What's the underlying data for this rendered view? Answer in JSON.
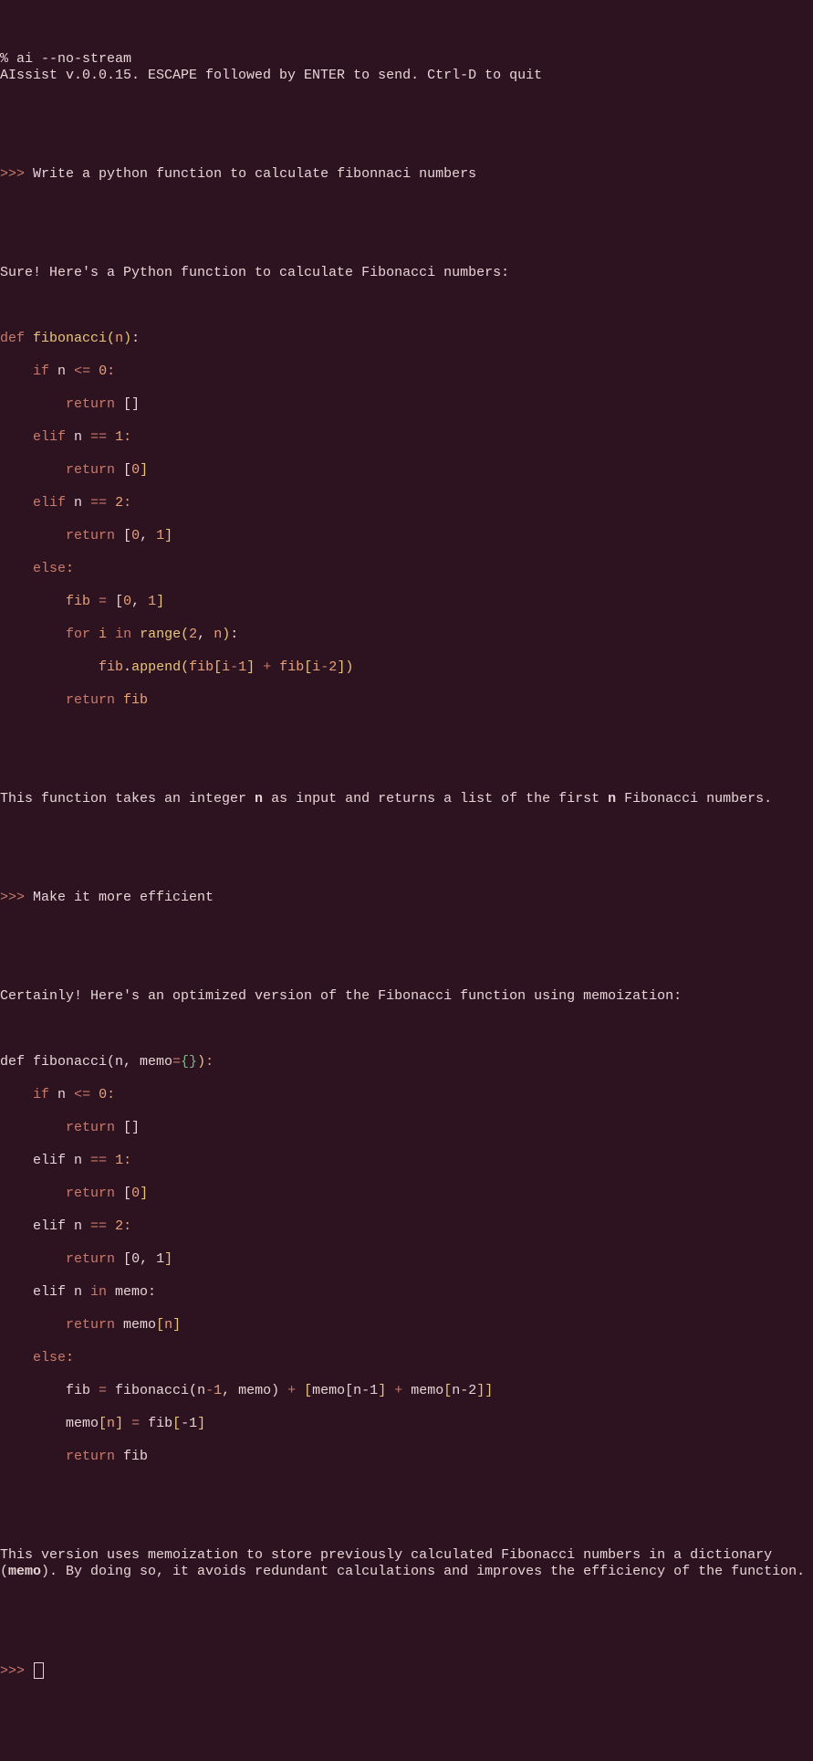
{
  "shell": {
    "prompt": "%",
    "command": "ai --no-stream",
    "banner": "AIssist v.0.0.15. ESCAPE followed by ENTER to send. Ctrl-D to quit"
  },
  "repl_prompt": ">>>",
  "turns": [
    {
      "user": "Write a python function to calculate fibonnaci numbers",
      "assistant_intro": "Sure! Here's a Python function to calculate Fibonacci numbers:",
      "code": [
        {
          "type": "def",
          "name": "fibonacci",
          "params": [
            "n"
          ]
        },
        {
          "type": "if",
          "cond": "n <= 0"
        },
        {
          "type": "return",
          "val": "[]"
        },
        {
          "type": "elif",
          "cond": "n == 1"
        },
        {
          "type": "return",
          "val": "[0]"
        },
        {
          "type": "elif",
          "cond": "n == 2"
        },
        {
          "type": "return",
          "val": "[0, 1]"
        },
        {
          "type": "else"
        },
        {
          "type": "assign",
          "lhs": "fib",
          "rhs": "[0, 1]"
        },
        {
          "type": "for",
          "var": "i",
          "iter": "range(2, n)"
        },
        {
          "type": "stmt",
          "text": "fib.append(fib[i-1] + fib[i-2])"
        },
        {
          "type": "return",
          "val": "fib"
        }
      ],
      "assistant_outro_pre": "This function takes an integer ",
      "assistant_outro_bold1": "n",
      "assistant_outro_mid": " as input and returns a list of the first ",
      "assistant_outro_bold2": "n",
      "assistant_outro_post": " Fibonacci numbers."
    },
    {
      "user": "Make it more efficient",
      "assistant_intro": "Certainly! Here's an optimized version of the Fibonacci function using memoization:",
      "code": [
        {
          "type": "def2",
          "text": "def fibonacci(n, memo={}):"
        },
        {
          "type": "if",
          "cond": "n <= 0"
        },
        {
          "type": "return",
          "val": "[]"
        },
        {
          "type": "elif2",
          "cond": "n == 1"
        },
        {
          "type": "return",
          "val": "[0]"
        },
        {
          "type": "elif2",
          "cond": "n == 2"
        },
        {
          "type": "return",
          "val": "[0, 1]"
        },
        {
          "type": "elifin",
          "cond": "n in memo"
        },
        {
          "type": "return",
          "val": "memo[n]"
        },
        {
          "type": "else"
        },
        {
          "type": "assign2",
          "text": "fib = fibonacci(n-1, memo) + [memo[n-1] + memo[n-2]]"
        },
        {
          "type": "assign3",
          "text": "memo[n] = fib[-1]"
        },
        {
          "type": "return",
          "val": "fib"
        }
      ],
      "assistant_outro_pre": "This version uses memoization to store previously calculated Fibonacci numbers in a dictionary (",
      "assistant_outro_bold1": "memo",
      "assistant_outro_post": "). By doing so, it avoids redundant calculations and improves the efficiency of the function."
    }
  ]
}
